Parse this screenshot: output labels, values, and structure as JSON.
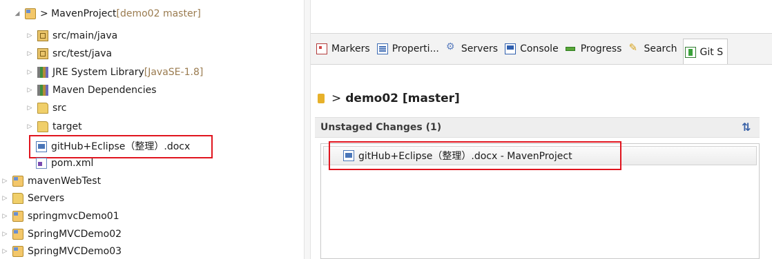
{
  "explorer": {
    "items": [
      {
        "label": "> MavenProject",
        "decoration": " [demo02 master]"
      },
      {
        "label": "src/main/java",
        "decoration": ""
      },
      {
        "label": "src/test/java",
        "decoration": ""
      },
      {
        "label": "JRE System Library",
        "decoration": " [JavaSE-1.8]"
      },
      {
        "label": "Maven Dependencies",
        "decoration": ""
      },
      {
        "label": "src",
        "decoration": ""
      },
      {
        "label": "target",
        "decoration": ""
      },
      {
        "label": "gitHub+Eclipse（整理）.docx",
        "decoration": ""
      },
      {
        "label": "pom.xml",
        "decoration": ""
      },
      {
        "label": "mavenWebTest",
        "decoration": ""
      },
      {
        "label": "Servers",
        "decoration": ""
      },
      {
        "label": "springmvcDemo01",
        "decoration": ""
      },
      {
        "label": "SpringMVCDemo02",
        "decoration": ""
      },
      {
        "label": "SpringMVCDemo03",
        "decoration": ""
      }
    ]
  },
  "views": {
    "tabs": [
      {
        "label": "Markers",
        "icon": "markers-icon"
      },
      {
        "label": "Properti...",
        "icon": "properties-icon"
      },
      {
        "label": "Servers",
        "icon": "servers-icon"
      },
      {
        "label": "Console",
        "icon": "console-icon"
      },
      {
        "label": "Progress",
        "icon": "progress-icon"
      },
      {
        "label": "Search",
        "icon": "search-icon"
      },
      {
        "label": "Git S",
        "icon": "git-staging-icon"
      }
    ]
  },
  "git": {
    "repo_prefix": ">",
    "repo_label": "demo02 [master]",
    "section_title": "Unstaged Changes (1)",
    "file_entry": "gitHub+Eclipse（整理）.docx - MavenProject"
  },
  "colors": {
    "highlight": "#e0141e",
    "decoration": "#9a7b4f"
  }
}
